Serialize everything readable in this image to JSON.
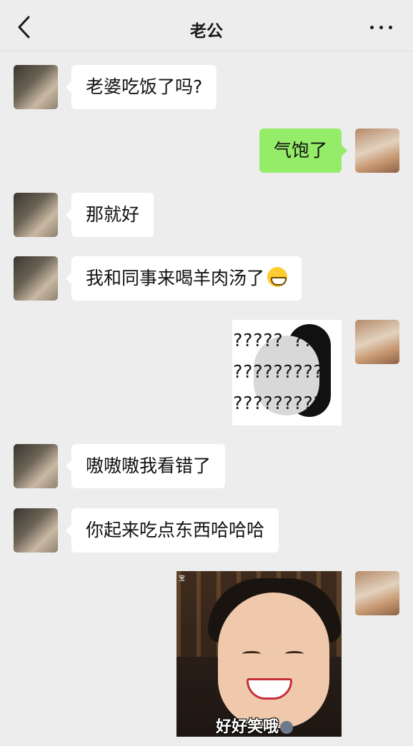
{
  "header": {
    "title": "老公",
    "back_icon": "chevron-left-icon",
    "more_icon": "more-dots-icon"
  },
  "messages": [
    {
      "side": "left",
      "text": "老婆吃饭了吗?"
    },
    {
      "side": "right",
      "text": "气饱了"
    },
    {
      "side": "left",
      "text": "那就好"
    },
    {
      "side": "left",
      "text": "我和同事来喝羊肉汤了",
      "emoji": "grinning-face-icon"
    },
    {
      "side": "right",
      "sticker": "question-panda-sticker",
      "sticker_text": [
        "?????  ??",
        "?????????",
        "?????????"
      ]
    },
    {
      "side": "left",
      "text": "嗷嗷嗷我看错了"
    },
    {
      "side": "left",
      "text": "你起来吃点东西哈哈哈"
    },
    {
      "side": "right",
      "sticker": "laughing-girl-sticker",
      "caption": "好好笑哦",
      "tag": "宝"
    }
  ],
  "colors": {
    "background": "#ededed",
    "incoming_bubble": "#ffffff",
    "outgoing_bubble": "#95ec69"
  }
}
